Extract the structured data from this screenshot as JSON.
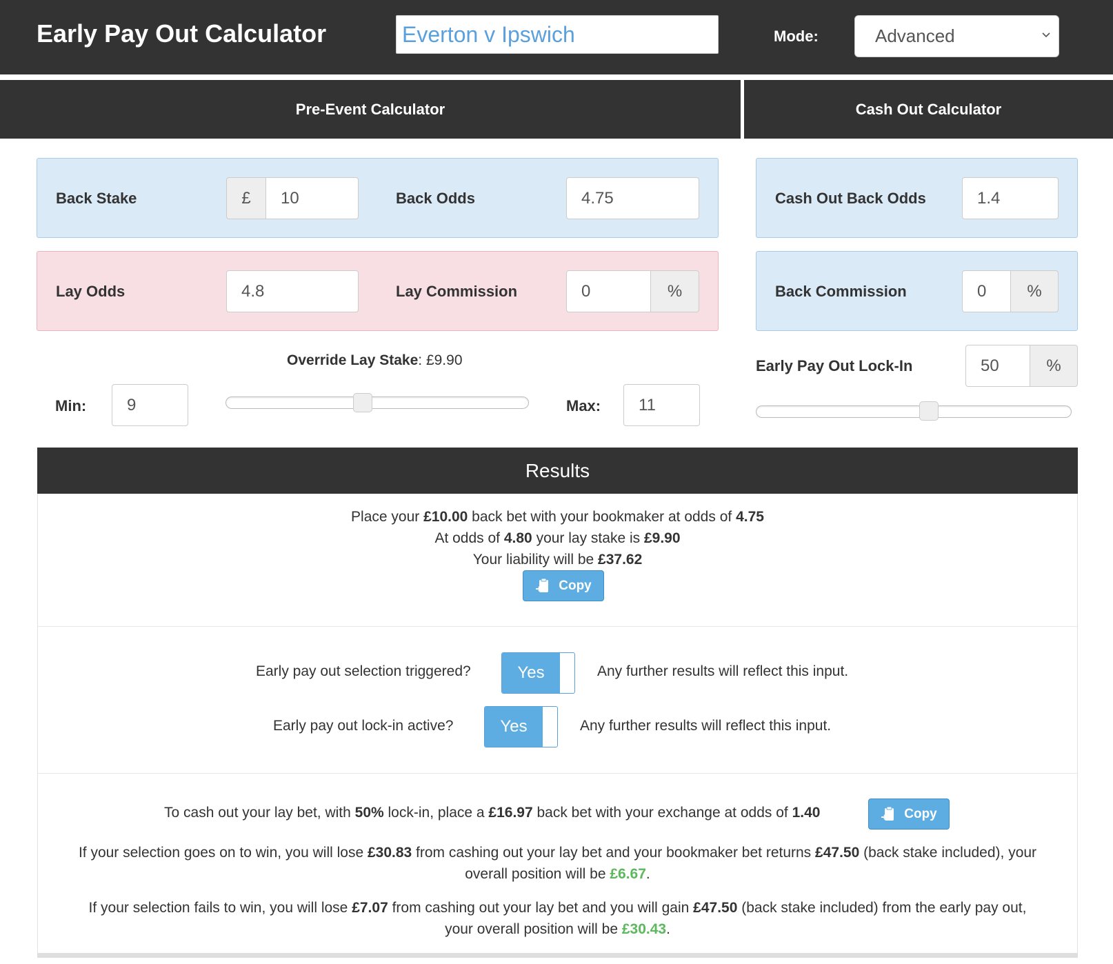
{
  "header": {
    "title": "Early Pay Out Calculator",
    "event_name": "Everton v Ipswich",
    "mode_label": "Mode:",
    "mode_value": "Advanced"
  },
  "tabs": [
    {
      "label": "Pre-Event Calculator"
    },
    {
      "label": "Cash Out Calculator"
    }
  ],
  "pre_event": {
    "back_stake_label": "Back Stake",
    "currency_symbol": "£",
    "back_stake": "10",
    "back_odds_label": "Back Odds",
    "back_odds": "4.75",
    "lay_odds_label": "Lay Odds",
    "lay_odds": "4.8",
    "lay_commission_label": "Lay Commission",
    "lay_commission": "0",
    "percent": "%",
    "override_label": "Override Lay Stake",
    "override_value": ": £9.90",
    "min_label": "Min:",
    "min_value": "9",
    "max_label": "Max:",
    "max_value": "11",
    "slider_fraction": 0.45
  },
  "cash_out": {
    "back_odds_label": "Cash Out Back Odds",
    "back_odds": "1.4",
    "back_commission_label": "Back Commission",
    "back_commission": "0",
    "percent": "%",
    "lockin_label": "Early Pay Out Lock-In",
    "lockin_value": "50",
    "slider_fraction": 0.55
  },
  "results": {
    "title": "Results",
    "l1": {
      "a": "Place your ",
      "b": "£10.00",
      "c": " back bet with your bookmaker at odds of ",
      "d": "4.75"
    },
    "l2": {
      "a": "At odds of ",
      "b": "4.80",
      "c": " your lay stake is ",
      "d": "£9.90"
    },
    "l3": {
      "a": "Your liability will be ",
      "b": "£37.62"
    },
    "copy_label": "Copy",
    "q1": "Early pay out selection triggered?",
    "q1_toggle": "Yes",
    "q1_note": "Any further results will reflect this input.",
    "q2": "Early pay out lock-in active?",
    "q2_toggle": "Yes",
    "q2_note": "Any further results will reflect this input.",
    "cash": {
      "a": "To cash out your lay bet, with ",
      "b": "50%",
      "c": " lock-in, place a ",
      "d": "£16.97",
      "e": " back bet with your exchange at odds of ",
      "f": "1.40"
    },
    "win": {
      "a": "If your selection goes on to win, you will lose ",
      "b": "£30.83",
      "c": " from cashing out your lay bet and your bookmaker bet returns ",
      "d": "£47.50",
      "e": " (back stake included), your",
      "f": "overall position will be ",
      "g": "£6.67",
      "h": "."
    },
    "fail": {
      "a": "If your selection fails to win, you will lose ",
      "b": "£7.07",
      "c": " from cashing out your lay bet and you will gain ",
      "d": "£47.50",
      "e": " (back stake included) from the early pay out,",
      "f": "your overall position will be ",
      "g": "£30.43",
      "h": "."
    }
  },
  "colors": {
    "header_bg": "#333333",
    "panel_blue": "#dbeaf7",
    "panel_pink": "#f8dfe4",
    "button_blue": "#5dade2",
    "positive_green": "#5cb85c"
  },
  "icons": [
    "chevron-down-icon",
    "clipboard-icon"
  ]
}
